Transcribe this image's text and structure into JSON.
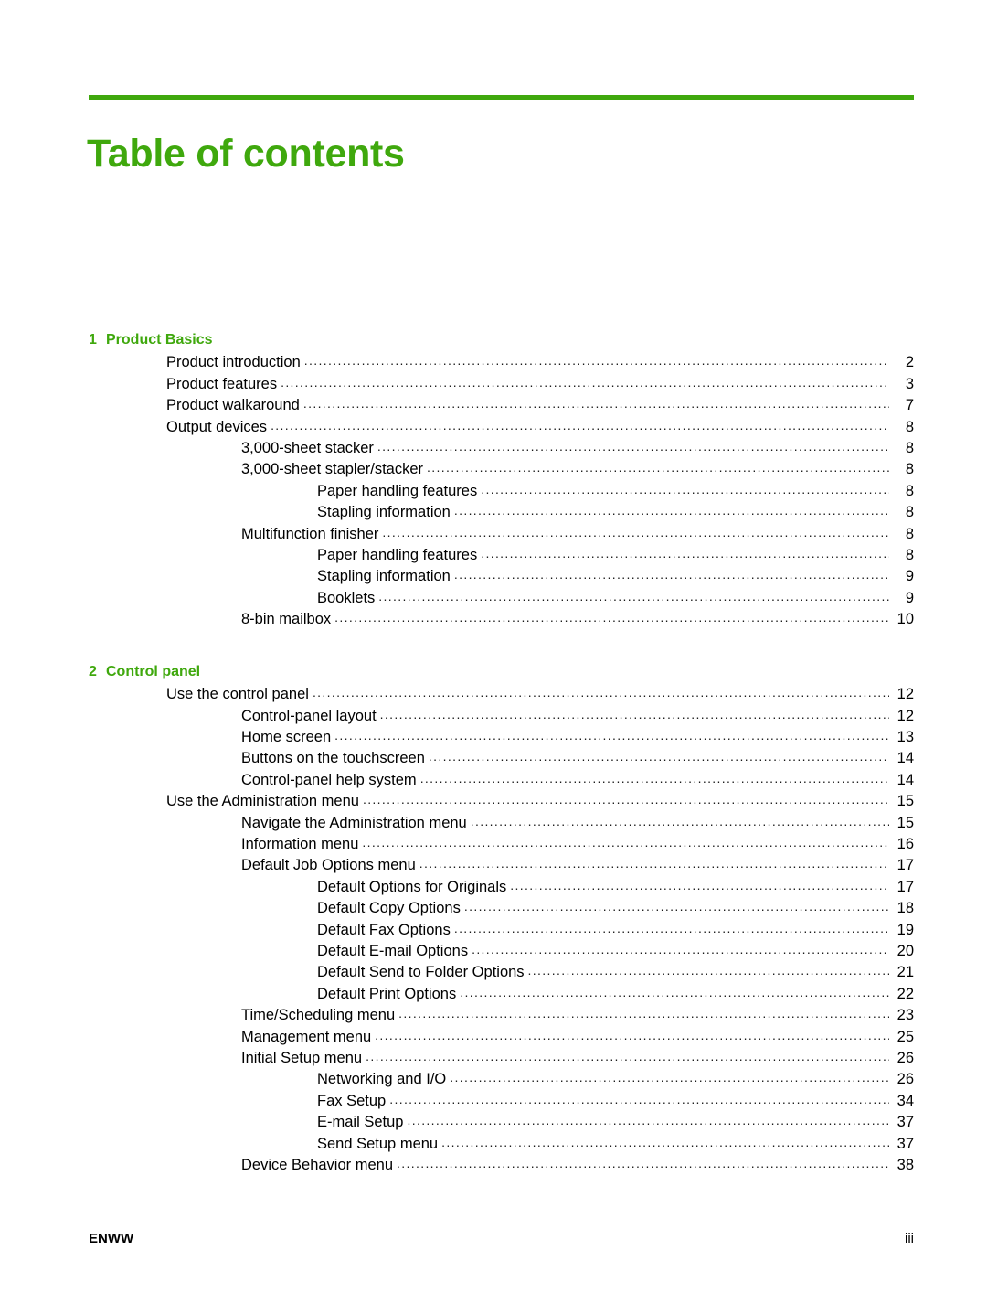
{
  "document": {
    "title": "Table of contents",
    "accent_color": "#3fa80d",
    "text_color": "#000000",
    "leader_char": "."
  },
  "footer": {
    "left_label": "ENWW",
    "page_number": "iii"
  },
  "toc": {
    "chapters": [
      {
        "number": "1",
        "title": "Product Basics",
        "entries": [
          {
            "level": 1,
            "label": "Product introduction",
            "page": "2"
          },
          {
            "level": 1,
            "label": "Product features",
            "page": "3"
          },
          {
            "level": 1,
            "label": "Product walkaround",
            "page": "7"
          },
          {
            "level": 1,
            "label": "Output devices",
            "page": "8"
          },
          {
            "level": 2,
            "label": "3,000-sheet stacker",
            "page": "8"
          },
          {
            "level": 2,
            "label": "3,000-sheet stapler/stacker",
            "page": "8"
          },
          {
            "level": 3,
            "label": "Paper handling features",
            "page": "8"
          },
          {
            "level": 3,
            "label": "Stapling information",
            "page": "8"
          },
          {
            "level": 2,
            "label": "Multifunction finisher",
            "page": "8"
          },
          {
            "level": 3,
            "label": "Paper handling features",
            "page": "8"
          },
          {
            "level": 3,
            "label": "Stapling information",
            "page": "9"
          },
          {
            "level": 3,
            "label": "Booklets",
            "page": "9"
          },
          {
            "level": 2,
            "label": "8-bin mailbox",
            "page": "10"
          }
        ]
      },
      {
        "number": "2",
        "title": "Control panel",
        "entries": [
          {
            "level": 1,
            "label": "Use the control panel",
            "page": "12"
          },
          {
            "level": 2,
            "label": "Control-panel layout",
            "page": "12"
          },
          {
            "level": 2,
            "label": "Home screen",
            "page": "13"
          },
          {
            "level": 2,
            "label": "Buttons on the touchscreen",
            "page": "14"
          },
          {
            "level": 2,
            "label": "Control-panel help system",
            "page": "14"
          },
          {
            "level": 1,
            "label": "Use the Administration menu",
            "page": "15"
          },
          {
            "level": 2,
            "label": "Navigate the Administration menu",
            "page": "15"
          },
          {
            "level": 2,
            "label": "Information menu",
            "page": "16"
          },
          {
            "level": 2,
            "label": "Default Job Options menu",
            "page": "17"
          },
          {
            "level": 3,
            "label": "Default Options for Originals",
            "page": "17"
          },
          {
            "level": 3,
            "label": "Default Copy Options",
            "page": "18"
          },
          {
            "level": 3,
            "label": "Default Fax Options",
            "page": "19"
          },
          {
            "level": 3,
            "label": "Default E-mail Options",
            "page": "20"
          },
          {
            "level": 3,
            "label": "Default Send to Folder Options",
            "page": "21"
          },
          {
            "level": 3,
            "label": "Default Print Options",
            "page": "22"
          },
          {
            "level": 2,
            "label": "Time/Scheduling menu",
            "page": "23"
          },
          {
            "level": 2,
            "label": "Management menu",
            "page": "25"
          },
          {
            "level": 2,
            "label": "Initial Setup menu",
            "page": "26"
          },
          {
            "level": 3,
            "label": "Networking and I/O",
            "page": "26"
          },
          {
            "level": 3,
            "label": "Fax Setup",
            "page": "34"
          },
          {
            "level": 3,
            "label": "E-mail Setup",
            "page": "37"
          },
          {
            "level": 3,
            "label": "Send Setup menu",
            "page": "37"
          },
          {
            "level": 2,
            "label": "Device Behavior menu",
            "page": "38"
          }
        ]
      }
    ]
  }
}
